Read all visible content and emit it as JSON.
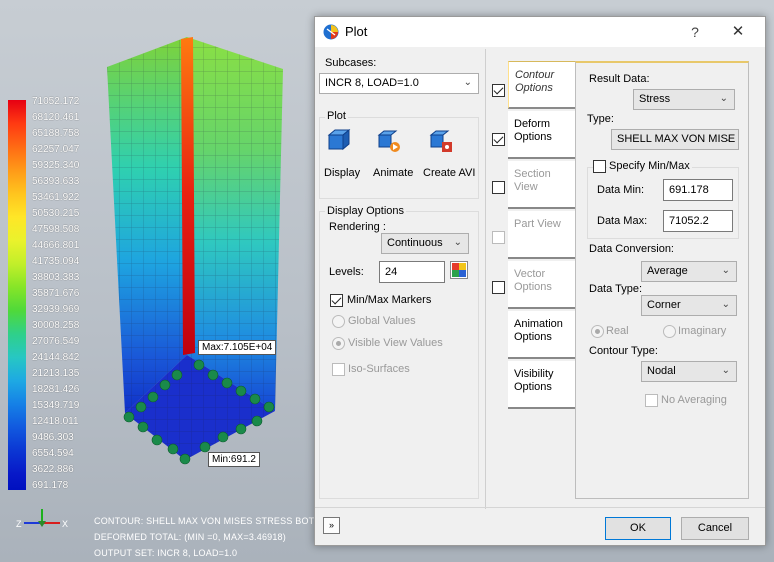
{
  "viewport": {
    "legend": [
      "71052.172",
      "68120.461",
      "65188.758",
      "62257.047",
      "59325.340",
      "56393.633",
      "53461.922",
      "50530.215",
      "47598.508",
      "44666.801",
      "41735.094",
      "38803.383",
      "35871.676",
      "32939.969",
      "30008.258",
      "27076.549",
      "24144.842",
      "21213.135",
      "18281.426",
      "15349.719",
      "12418.011",
      "9486.303",
      "6554.594",
      "3622.886",
      "691.178"
    ],
    "max_label": "Max:7.105E+04",
    "min_label": "Min:691.2",
    "axes": {
      "z": "Z",
      "x": "X"
    },
    "footer": [
      "CONTOUR: SHELL MAX VON MISES STRESS BOTT",
      "DEFORMED TOTAL: (MIN    =0, MAX=3.46918)",
      "OUTPUT SET: INCR 8, LOAD=1.0"
    ]
  },
  "dialog": {
    "title": "Plot",
    "help": "?",
    "close": "✕",
    "subcases_label": "Subcases:",
    "subcase_value": "INCR 8, LOAD=1.0",
    "plot_group": "Plot",
    "plot_buttons": [
      "Display",
      "Animate",
      "Create AVI"
    ],
    "display_options": "Display Options",
    "rendering_label": "Rendering :",
    "rendering_value": "Continuous",
    "levels_label": "Levels:",
    "levels_value": "24",
    "minmax_markers": "Min/Max Markers",
    "global_values": "Global Values",
    "visible_view_values": "Visible View Values",
    "iso_surfaces": "Iso-Surfaces",
    "tabs": [
      {
        "label": "Contour Options",
        "checked": true
      },
      {
        "label": "Deform Options",
        "checked": true
      },
      {
        "label": "Section View",
        "checked": false
      },
      {
        "label": "Part View",
        "checked": false
      },
      {
        "label": "Vector Options",
        "checked": false
      },
      {
        "label": "Animation Options"
      },
      {
        "label": "Visibility Options"
      }
    ],
    "result_data_label": "Result Data:",
    "result_data_value": "Stress",
    "type_label": "Type:",
    "type_value": "SHELL MAX VON MISE",
    "specify_minmax": "Specify Min/Max",
    "data_min_label": "Data Min:",
    "data_min_value": "691.178",
    "data_max_label": "Data Max:",
    "data_max_value": "71052.2",
    "data_conversion_label": "Data Conversion:",
    "data_conversion_value": "Average",
    "data_type_label": "Data Type:",
    "data_type_value": "Corner",
    "real_label": "Real",
    "imaginary_label": "Imaginary",
    "contour_type_label": "Contour Type:",
    "contour_type_value": "Nodal",
    "no_averaging": "No Averaging",
    "expand": "»",
    "ok": "OK",
    "cancel": "Cancel"
  }
}
